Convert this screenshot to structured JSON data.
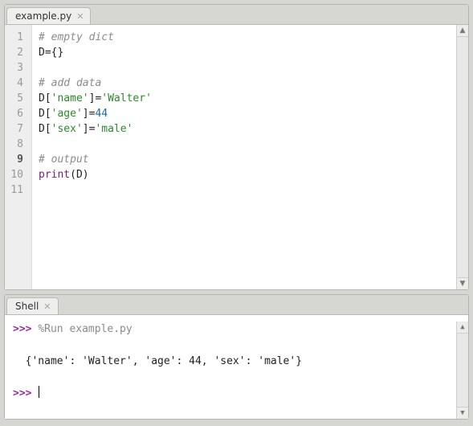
{
  "editor": {
    "tab_label": "example.py",
    "line_numbers": [
      "1",
      "2",
      "3",
      "4",
      "5",
      "6",
      "7",
      "8",
      "9",
      "10",
      "11"
    ],
    "active_line": 9,
    "code": {
      "l1_comment": "# empty dict",
      "l2_var": "D",
      "l2_assign": "={}",
      "l4_comment": "# add data",
      "l5_var": "D",
      "l5_key": "'name'",
      "l5_val": "'Walter'",
      "l6_var": "D",
      "l6_key": "'age'",
      "l6_val": "44",
      "l7_var": "D",
      "l7_key": "'sex'",
      "l7_val": "'male'",
      "l9_comment": "# output",
      "l10_fun": "print",
      "l10_arg": "D"
    }
  },
  "shell": {
    "tab_label": "Shell",
    "prompt": ">>>",
    "run_cmd": "%Run example.py",
    "output": "{'name': 'Walter', 'age': 44, 'sex': 'male'}"
  }
}
